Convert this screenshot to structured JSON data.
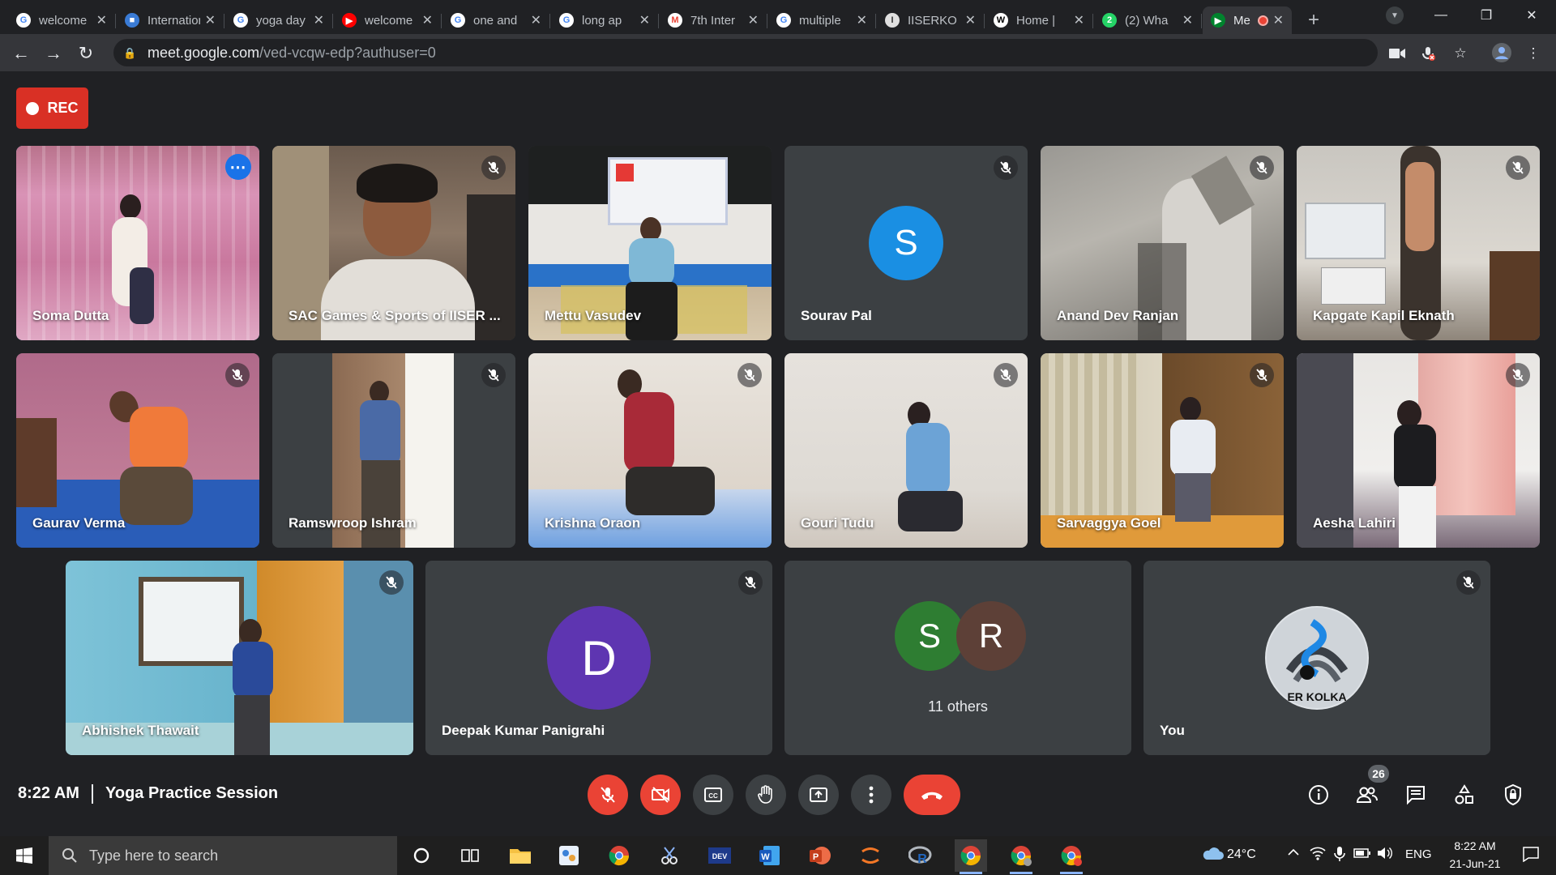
{
  "browser": {
    "tabs": [
      {
        "title": "welcome",
        "icon": "google-icon"
      },
      {
        "title": "International",
        "icon": "site-icon"
      },
      {
        "title": "yoga day",
        "icon": "google-icon"
      },
      {
        "title": "welcome",
        "icon": "youtube-icon"
      },
      {
        "title": "one and",
        "icon": "google-icon"
      },
      {
        "title": "long ap",
        "icon": "google-icon"
      },
      {
        "title": "7th Inter",
        "icon": "gmail-icon"
      },
      {
        "title": "multiple",
        "icon": "google-icon"
      },
      {
        "title": "IISERKO",
        "icon": "iiser-icon"
      },
      {
        "title": "Home |",
        "icon": "wix-icon"
      },
      {
        "title": "(2) Wha",
        "icon": "whatsapp-icon"
      },
      {
        "title": "Me",
        "icon": "meet-icon",
        "active": true
      }
    ],
    "new_tab_label": "+",
    "url_host": "meet.google.com",
    "url_path": "/ved-vcqw-edp?authuser=0"
  },
  "meet": {
    "rec_label": "REC",
    "participants": [
      {
        "name": "Soma Dutta"
      },
      {
        "name": "SAC Games & Sports of IISER ..."
      },
      {
        "name": "Mettu Vasudev"
      },
      {
        "name": "Sourav Pal",
        "initial": "S",
        "color": "#1a8fe3"
      },
      {
        "name": "Anand Dev Ranjan"
      },
      {
        "name": "Kapgate Kapil Eknath"
      },
      {
        "name": "Gaurav Verma"
      },
      {
        "name": "Ramswroop Ishram"
      },
      {
        "name": "Krishna Oraon"
      },
      {
        "name": "Gouri Tudu"
      },
      {
        "name": "Sarvaggya Goel"
      },
      {
        "name": "Aesha Lahiri"
      },
      {
        "name": "Abhishek Thawait"
      },
      {
        "name": "Deepak Kumar Panigrahi",
        "initial": "D",
        "color": "#5e35b1"
      },
      {
        "name": "11 others",
        "initials": [
          "S",
          "R"
        ],
        "colors": [
          "#2e7d32",
          "#5d4037"
        ]
      },
      {
        "name": "You",
        "logo_text": "ER KOLKA"
      }
    ],
    "clock": "8:22 AM",
    "meeting_title": "Yoga Practice Session",
    "participant_count": "26"
  },
  "taskbar": {
    "search_placeholder": "Type here to search",
    "weather": "24°C",
    "language": "ENG",
    "time": "8:22 AM",
    "date": "21-Jun-21"
  }
}
